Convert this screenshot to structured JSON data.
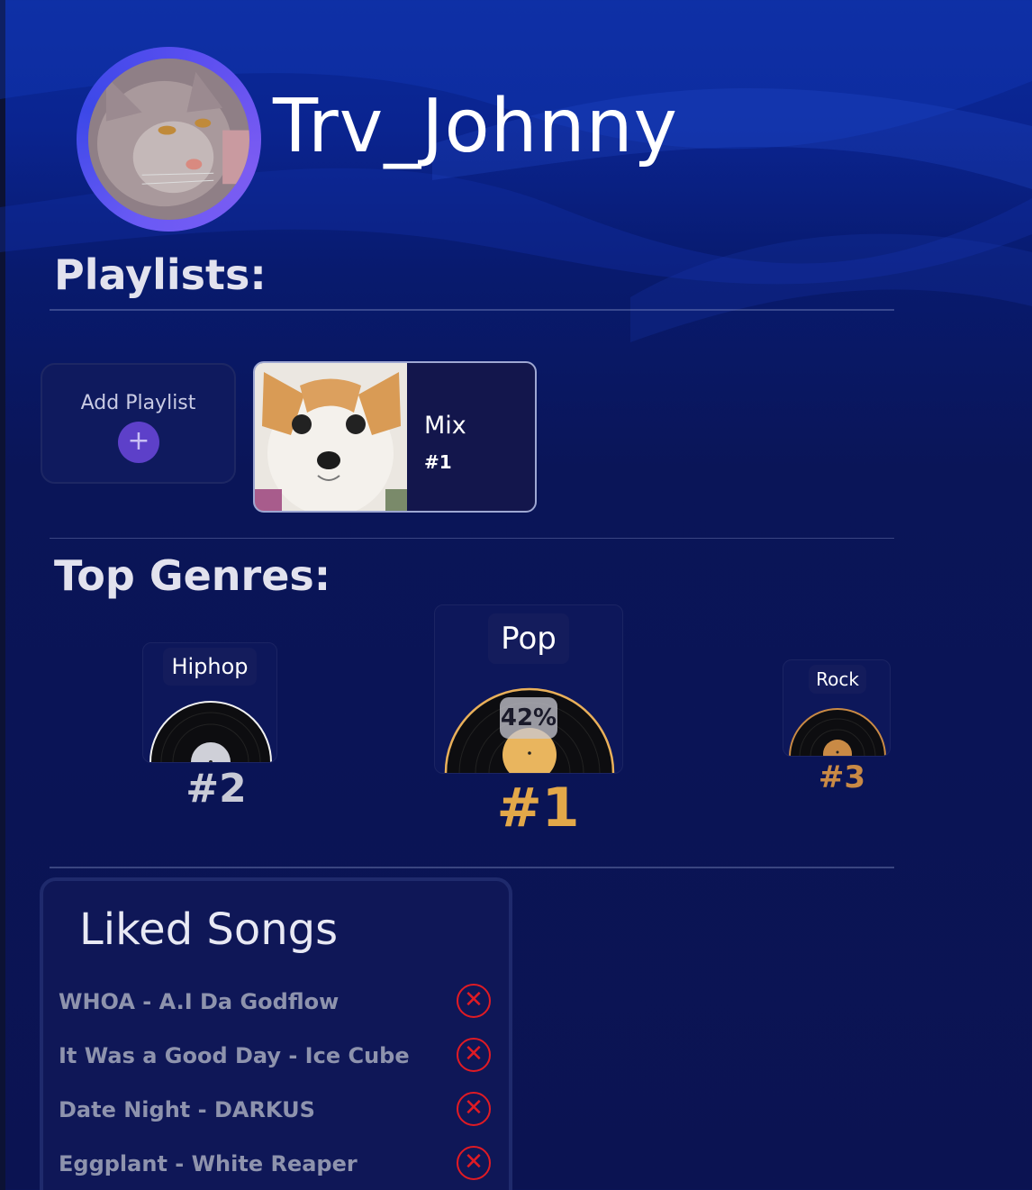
{
  "profile": {
    "username": "Trv_Johnny",
    "avatar_icon": "cat-photo"
  },
  "playlists": {
    "title": "Playlists:",
    "add_label": "Add Playlist",
    "add_icon": "+",
    "items": [
      {
        "name": "Mix",
        "sub": "#1",
        "cover_icon": "dog-photo"
      }
    ]
  },
  "genres": {
    "title": "Top Genres:",
    "items": [
      {
        "name": "Hiphop",
        "rank": "#2",
        "accent": "#cfd0d8"
      },
      {
        "name": "Pop",
        "rank": "#1",
        "percent": "42%",
        "accent": "#e9b05a"
      },
      {
        "name": "Rock",
        "rank": "#3",
        "accent": "#c98a45"
      }
    ]
  },
  "liked": {
    "title": "Liked Songs",
    "remove_icon": "✕",
    "songs": [
      "WHOA - A.I Da Godflow",
      "It Was a Good Day - Ice Cube",
      "Date Night - DARKUS",
      "Eggplant - White Reaper"
    ]
  },
  "colors": {
    "remove": "#e01b24",
    "rank1": "#e3a849",
    "rank2": "#c8cad6",
    "rank3": "#c98a45"
  }
}
